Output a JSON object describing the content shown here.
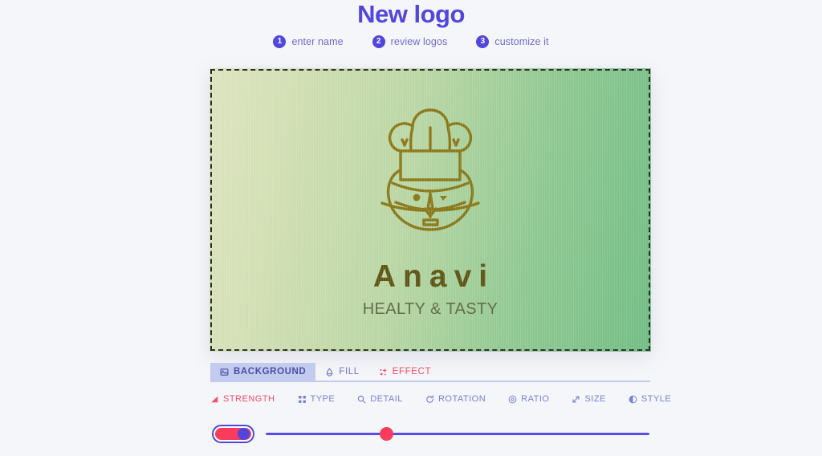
{
  "header": {
    "title": "New logo",
    "title_color": "#5146dd",
    "steps": [
      {
        "num": "1",
        "label": "enter name"
      },
      {
        "num": "2",
        "label": "review logos"
      },
      {
        "num": "3",
        "label": "customize it"
      }
    ]
  },
  "canvas": {
    "logo_name": "Anavi",
    "logo_tagline": "HEALTY & TASTY",
    "logo_mark_icon": "chef-face-icon",
    "mark_color": "#8a7718",
    "name_color": "#5e5515",
    "tagline_color": "#5f6a44",
    "background_gradient_from": "#dde4bf",
    "background_gradient_to": "#72bd85",
    "selection_border": "dashed"
  },
  "tabs": [
    {
      "label": "BACKGROUND",
      "icon": "image-icon",
      "active": true,
      "accent": false
    },
    {
      "label": "FILL",
      "icon": "droplet-icon",
      "active": false,
      "accent": false
    },
    {
      "label": "EFFECT",
      "icon": "sparkle-icon",
      "active": false,
      "accent": true
    }
  ],
  "properties": [
    {
      "label": "STRENGTH",
      "icon": "signal-bars-icon",
      "active": true
    },
    {
      "label": "TYPE",
      "icon": "grid-icon",
      "active": false
    },
    {
      "label": "DETAIL",
      "icon": "magnifier-icon",
      "active": false
    },
    {
      "label": "ROTATION",
      "icon": "rotate-icon",
      "active": false
    },
    {
      "label": "RATIO",
      "icon": "target-icon",
      "active": false
    },
    {
      "label": "SIZE",
      "icon": "resize-arrows-icon",
      "active": false
    },
    {
      "label": "STYLE",
      "icon": "contrast-circle-icon",
      "active": false
    }
  ],
  "controls": {
    "toggle": {
      "name": "strength-toggle",
      "state": "on",
      "on_color": "#fb3b5c",
      "knob_color": "#5146dd"
    },
    "slider": {
      "name": "strength-slider",
      "value_percent": 30,
      "track_color": "#5a4be9",
      "thumb_color": "#fb3b5c"
    }
  }
}
